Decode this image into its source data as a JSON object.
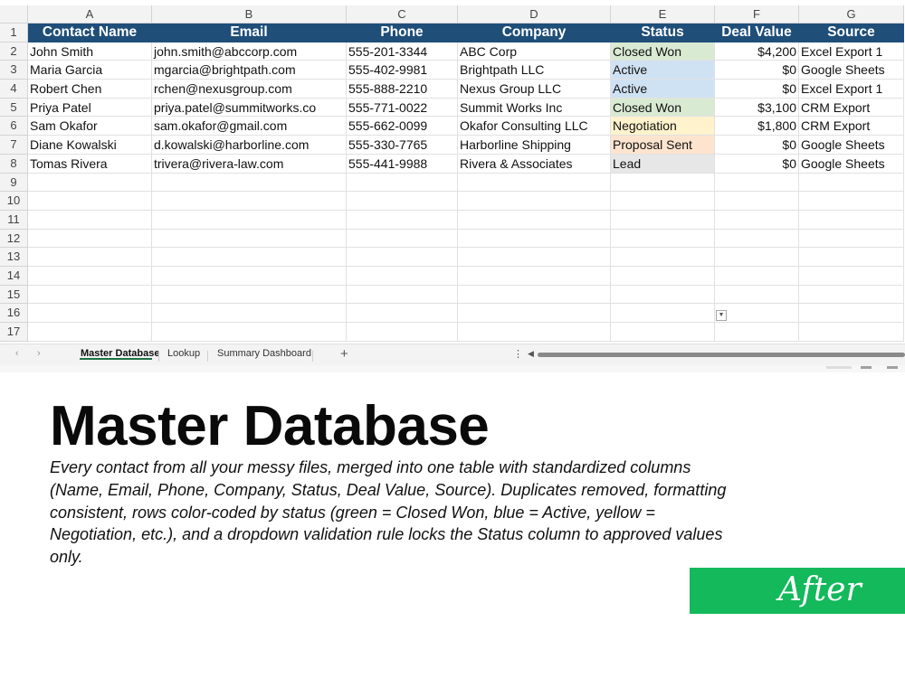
{
  "spreadsheet": {
    "columns": [
      "A",
      "B",
      "C",
      "D",
      "E",
      "F",
      "G"
    ],
    "headers": [
      "Contact Name",
      "Email",
      "Phone",
      "Company",
      "Status",
      "Deal Value",
      "Source"
    ],
    "row_numbers": [
      "1",
      "2",
      "3",
      "4",
      "5",
      "6",
      "7",
      "8",
      "9",
      "10",
      "11",
      "12",
      "13",
      "14",
      "15",
      "16",
      "17"
    ],
    "status_colors": {
      "Closed Won": "#d9ead3",
      "Active": "#cfe2f3",
      "Negotiation": "#fff2cc",
      "Proposal Sent": "#fde4cf",
      "Lead": "#e7e7e7"
    },
    "header_color": "#1f4e79",
    "rows": [
      [
        "John Smith",
        "john.smith@abccorp.com",
        "555-201-3344",
        "ABC Corp",
        "Closed Won",
        "$4,200",
        "Excel Export 1"
      ],
      [
        "Maria Garcia",
        "mgarcia@brightpath.com",
        "555-402-9981",
        "Brightpath LLC",
        "Active",
        "$0",
        "Google Sheets"
      ],
      [
        "Robert Chen",
        "rchen@nexusgroup.com",
        "555-888-2210",
        "Nexus Group LLC",
        "Active",
        "$0",
        "Excel Export 1"
      ],
      [
        "Priya Patel",
        "priya.patel@summitworks.co",
        "555-771-0022",
        "Summit Works Inc",
        "Closed Won",
        "$3,100",
        "CRM Export"
      ],
      [
        "Sam Okafor",
        "sam.okafor@gmail.com",
        "555-662-0099",
        "Okafor Consulting LLC",
        "Negotiation",
        "$1,800",
        "CRM Export"
      ],
      [
        "Diane Kowalski",
        "d.kowalski@harborline.com",
        "555-330-7765",
        "Harborline Shipping",
        "Proposal Sent",
        "$0",
        "Google Sheets"
      ],
      [
        "Tomas Rivera",
        "trivera@rivera-law.com",
        "555-441-9988",
        "Rivera & Associates",
        "Lead",
        "$0",
        "Google Sheets"
      ]
    ]
  },
  "tabs": {
    "prev_icon": "chevron-left-icon",
    "next_icon": "chevron-right-icon",
    "items": [
      "Master Database",
      "Lookup",
      "Summary Dashboard"
    ],
    "active": "Master Database",
    "add_icon": "plus-icon"
  },
  "caption": {
    "title": "Master Database",
    "description": "Every contact from all your messy files, merged into one table with standardized columns (Name, Email, Phone, Company, Status, Deal Value, Source). Duplicates removed, formatting consistent, rows color-coded by status (green = Closed Won, blue = Active, yellow = Negotiation, etc.), and a dropdown validation rule locks the Status column to approved values only.",
    "badge": "After",
    "badge_color": "#13b95b"
  }
}
